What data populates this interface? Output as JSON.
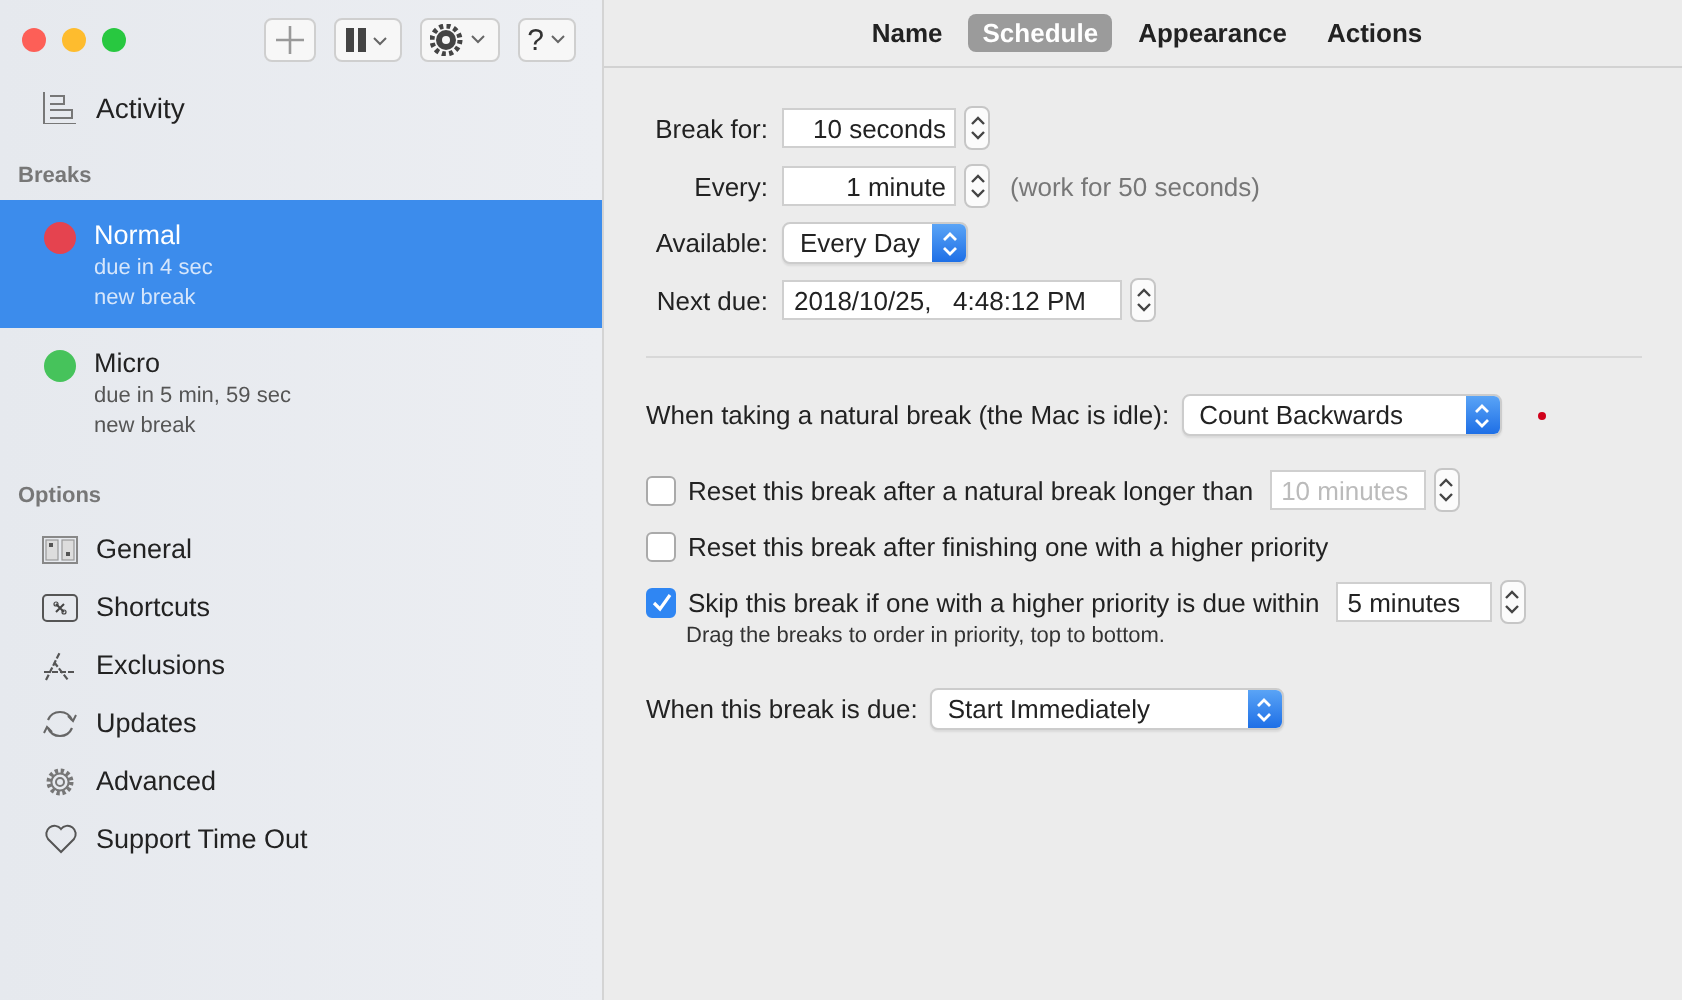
{
  "toolbar": {
    "help_label": "?"
  },
  "sidebar": {
    "activity": {
      "label": "Activity"
    },
    "breaks": {
      "heading": "Breaks",
      "items": [
        {
          "name": "Normal",
          "lines": [
            "due in 4 sec",
            "new break"
          ],
          "color": "#e5434f",
          "selected": true
        },
        {
          "name": "Micro",
          "lines": [
            "due in 5 min, 59 sec",
            "new break"
          ],
          "color": "#46c35b",
          "selected": false
        }
      ]
    },
    "options": {
      "heading": "Options",
      "items": [
        {
          "label": "General",
          "kind": "general"
        },
        {
          "label": "Shortcuts",
          "kind": "shortcuts"
        },
        {
          "label": "Exclusions",
          "kind": "exclusions"
        },
        {
          "label": "Updates",
          "kind": "updates"
        },
        {
          "label": "Advanced",
          "kind": "advanced"
        },
        {
          "label": "Support Time Out",
          "kind": "support"
        }
      ]
    }
  },
  "tabs": [
    {
      "label": "Name",
      "selected": false
    },
    {
      "label": "Schedule",
      "selected": true
    },
    {
      "label": "Appearance",
      "selected": false
    },
    {
      "label": "Actions",
      "selected": false
    }
  ],
  "schedule": {
    "break_for": {
      "label": "Break for:",
      "value": "10 seconds"
    },
    "every": {
      "label": "Every:",
      "value": "1 minute",
      "note": "(work for 50 seconds)"
    },
    "available": {
      "label": "Available:",
      "value": "Every Day"
    },
    "next_due": {
      "label": "Next due:",
      "value": "2018/10/25,   4:48:12 PM"
    }
  },
  "natural_break": {
    "label": "When taking a natural break (the Mac is idle):",
    "value": "Count Backwards"
  },
  "checks": [
    {
      "label": "Reset this break after a natural break longer than",
      "checked": false,
      "field": {
        "value": "10 minutes",
        "disabled": true
      }
    },
    {
      "label": "Reset this break after finishing one with a higher priority",
      "checked": false
    },
    {
      "label": "Skip this break if one with a higher priority is due within",
      "checked": true,
      "field": {
        "value": "5 minutes",
        "disabled": false
      }
    }
  ],
  "priority_note": "Drag the breaks to order in priority, top to bottom.",
  "when_due": {
    "label": "When this break is due:",
    "value": "Start Immediately"
  }
}
